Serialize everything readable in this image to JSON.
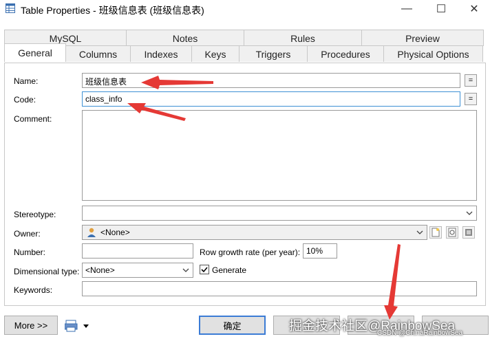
{
  "window": {
    "title": "Table Properties - 班级信息表 (班级信息表)",
    "min_glyph": "—",
    "max_glyph": "☐",
    "close_glyph": "✕"
  },
  "tabs_top": [
    "MySQL",
    "Notes",
    "Rules",
    "Preview"
  ],
  "tabs_bottom": [
    "General",
    "Columns",
    "Indexes",
    "Keys",
    "Triggers",
    "Procedures",
    "Physical Options"
  ],
  "active_tab": "General",
  "form": {
    "name_label": "Name:",
    "name_value": "班级信息表",
    "code_label": "Code:",
    "code_value": "class_info",
    "comment_label": "Comment:",
    "comment_value": "",
    "stereotype_label": "Stereotype:",
    "stereotype_value": "",
    "owner_label": "Owner:",
    "owner_value": "<None>",
    "number_label": "Number:",
    "number_value": "",
    "growth_label": "Row growth rate (per year):",
    "growth_value": "10%",
    "dimensional_label": "Dimensional type:",
    "dimensional_value": "<None>",
    "generate_label": "Generate",
    "generate_checked": true,
    "keywords_label": "Keywords:",
    "keywords_value": "",
    "equals_glyph": "="
  },
  "buttons": {
    "more": "More >>",
    "ok": "确定"
  },
  "watermark": {
    "line1": "掘金技术社区@RainbowSea",
    "line2": "CSDN @ChinaRainbowSea"
  },
  "colors": {
    "arrow": "#e53935",
    "focus": "#3c8fd4"
  }
}
